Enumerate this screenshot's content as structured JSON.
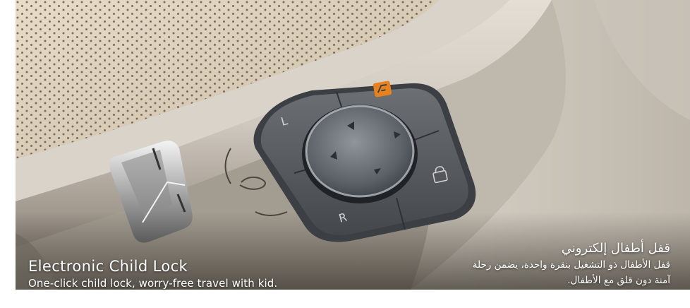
{
  "caption": {
    "english_title": "Electronic Child Lock",
    "english_subtitle": "One-click child lock, worry-free travel with kid.",
    "arabic_title": "قفل أطفال إلكتروني",
    "arabic_line_1": "قفل الأطفال ذو التشغيل بنقرة واحدة، يضمن رحلة",
    "arabic_line_2": "آمنة دون قلق مع الأطفال."
  },
  "photo": {
    "subject": "door-panel-mirror-control-with-child-lock-button",
    "button_labels": [
      "L",
      "R"
    ],
    "accent_color": "#e8821e",
    "panel_color": "#cfc9c0"
  }
}
